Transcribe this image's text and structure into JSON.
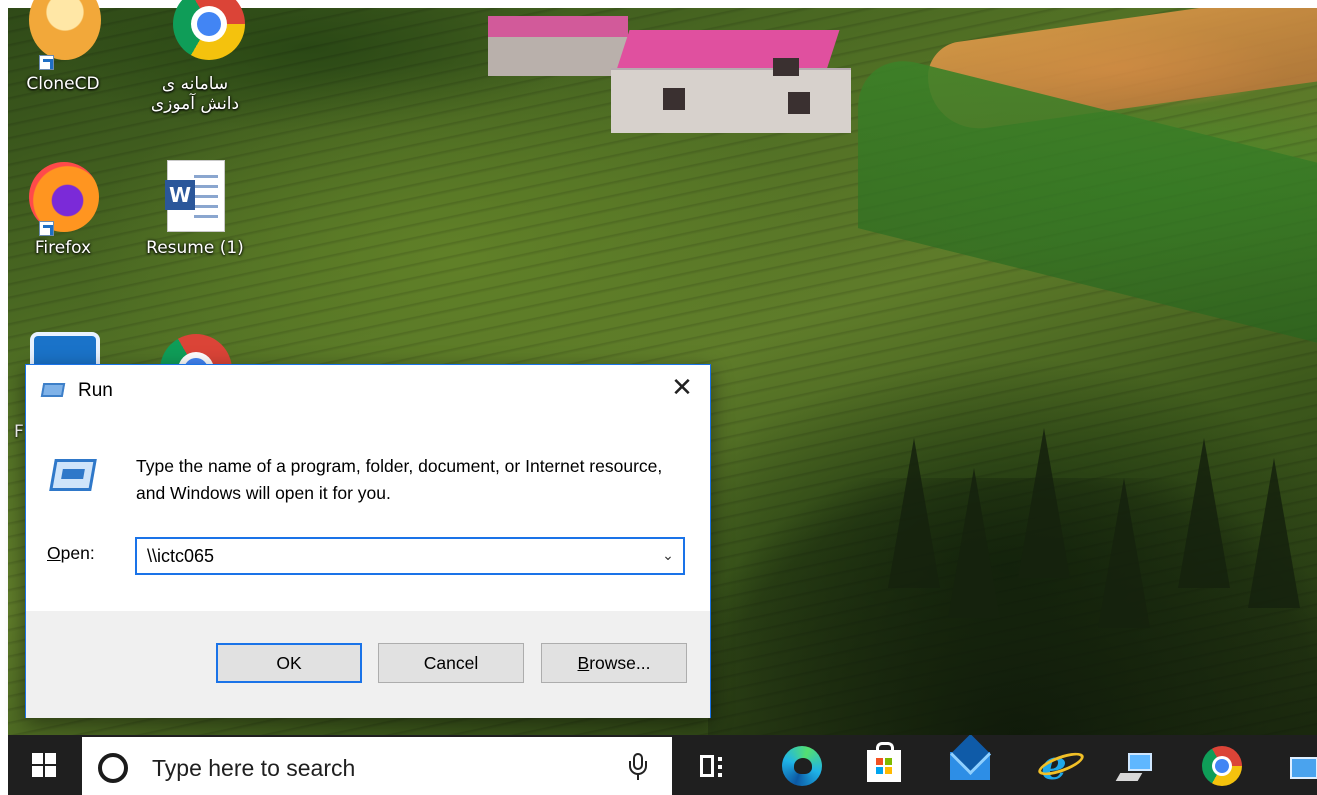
{
  "desktop": {
    "icons": [
      {
        "label": "CloneCD",
        "icon": "clonecd-icon"
      },
      {
        "label": "سامانه ی دانش آموزی",
        "icon": "chrome-icon"
      },
      {
        "label": "Firefox",
        "icon": "firefox-icon"
      },
      {
        "label": "Resume (1)",
        "icon": "word-document-icon"
      }
    ],
    "partial_letter": "F"
  },
  "run_dialog": {
    "title": "Run",
    "description": "Type the name of a program, folder, document, or Internet resource, and Windows will open it for you.",
    "open_label_accel": "O",
    "open_label_rest": "pen:",
    "open_value": "\\\\ictc065",
    "close_glyph": "✕",
    "dropdown_glyph": "⌄",
    "buttons": {
      "ok": "OK",
      "cancel": "Cancel",
      "browse_accel": "B",
      "browse_rest": "rowse..."
    },
    "accent_color": "#1a73e8"
  },
  "taskbar": {
    "search_placeholder": "Type here to search",
    "pinned_icons": [
      "task-view-icon",
      "edge-icon",
      "store-icon",
      "mail-icon",
      "internet-explorer-icon",
      "network-icon",
      "chrome-icon",
      "monitor-icon"
    ],
    "ie_glyph": "e",
    "word_badge": "W"
  }
}
